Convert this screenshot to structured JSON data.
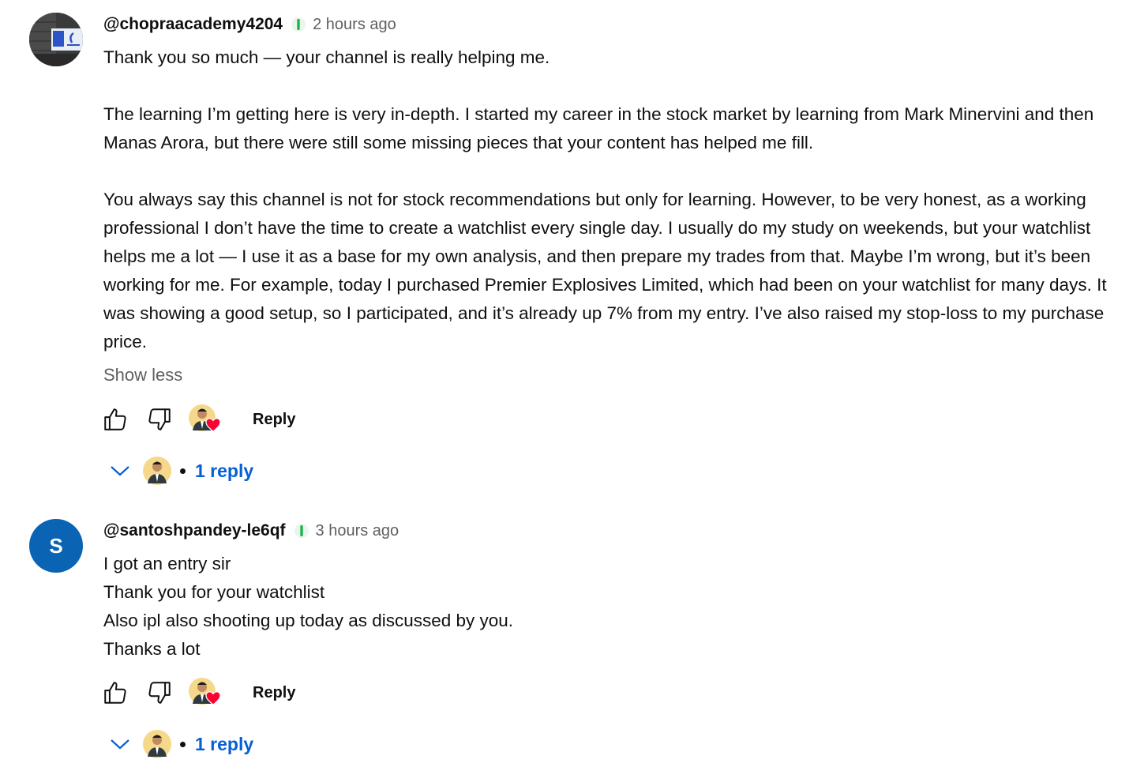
{
  "comments": [
    {
      "author": "@chopraacademy4204",
      "time": "2 hours ago",
      "avatar": {
        "type": "photo"
      },
      "paragraphs": [
        "Thank you so much — your channel is really helping me.",
        "The learning I’m getting here is very in-depth. I started my career in the stock market by learning from Mark Minervini and then Manas Arora, but there were still some missing pieces that your content has helped me fill.",
        "You always say this channel is not for stock recommendations but only for learning. However, to be very honest, as a working professional I don’t have the time to create a watchlist every single day. I usually do my study on weekends, but your watchlist helps me a lot — I use it as a base for my own analysis, and then prepare my trades from that. Maybe I’m wrong, but it’s been working for me. For example, today I purchased Premier Explosives Limited, which had been on your watchlist for many days. It was showing a good setup, so I participated, and it’s already up 7% from my entry. I’ve also raised my stop-loss to my purchase price."
      ],
      "show_less": "Show less",
      "reply_label": "Reply",
      "replies_label": "1 reply"
    },
    {
      "author": "@santoshpandey-le6qf",
      "time": "3 hours ago",
      "avatar": {
        "type": "letter",
        "letter": "S",
        "color": "#0a63b3"
      },
      "lines": [
        "I got an entry sir",
        "Thank you for your watchlist",
        "Also ipl also shooting up today as discussed by you.",
        "Thanks a lot"
      ],
      "reply_label": "Reply",
      "replies_label": "1 reply"
    }
  ],
  "icons": {
    "like": "thumbs-up-icon",
    "dislike": "thumbs-down-icon",
    "heart": "creator-heart-icon",
    "chevron": "chevron-down-icon",
    "member": "membership-badge-icon"
  },
  "colors": {
    "link": "#065fd4",
    "heart": "#ff0033",
    "muted": "#606060",
    "badge": "#22b14c"
  }
}
